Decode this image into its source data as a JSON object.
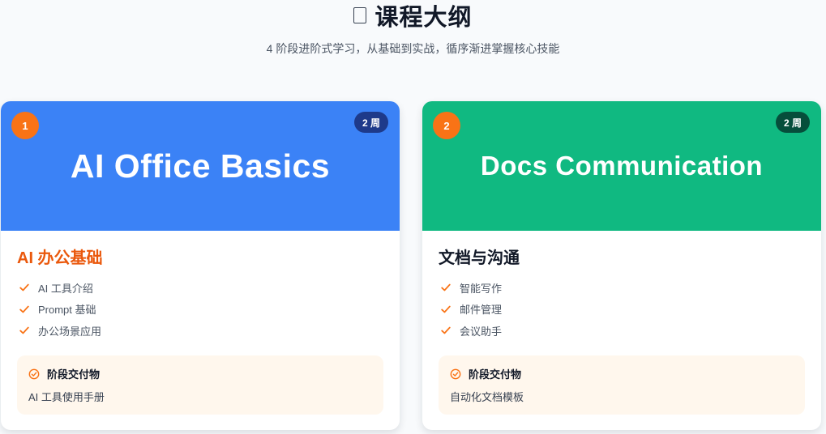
{
  "header": {
    "title": "课程大纲",
    "subtitle": "4 阶段进阶式学习，从基础到实战，循序渐进掌握核心技能"
  },
  "colors": {
    "accent": "#f97316",
    "card1_banner": "#3b82f6",
    "card1_weeks_badge": "#1e3a8a",
    "card2_banner": "#10b981",
    "card2_weeks_badge": "#064e3b",
    "deliverable_bg": "#fff7ed"
  },
  "cards": [
    {
      "number": "1",
      "weeks": "2 周",
      "banner_text": "AI Office Basics",
      "title": "AI 办公基础",
      "topics": [
        "AI 工具介绍",
        "Prompt 基础",
        "办公场景应用"
      ],
      "deliverable_label": "阶段交付物",
      "deliverable_value": "AI 工具使用手册"
    },
    {
      "number": "2",
      "weeks": "2 周",
      "banner_text": "Docs Communication",
      "title": "文档与沟通",
      "topics": [
        "智能写作",
        "邮件管理",
        "会议助手"
      ],
      "deliverable_label": "阶段交付物",
      "deliverable_value": "自动化文档模板"
    }
  ],
  "icons": {
    "title": "document-icon",
    "topic": "check-icon",
    "deliverable": "check-circle-icon"
  }
}
